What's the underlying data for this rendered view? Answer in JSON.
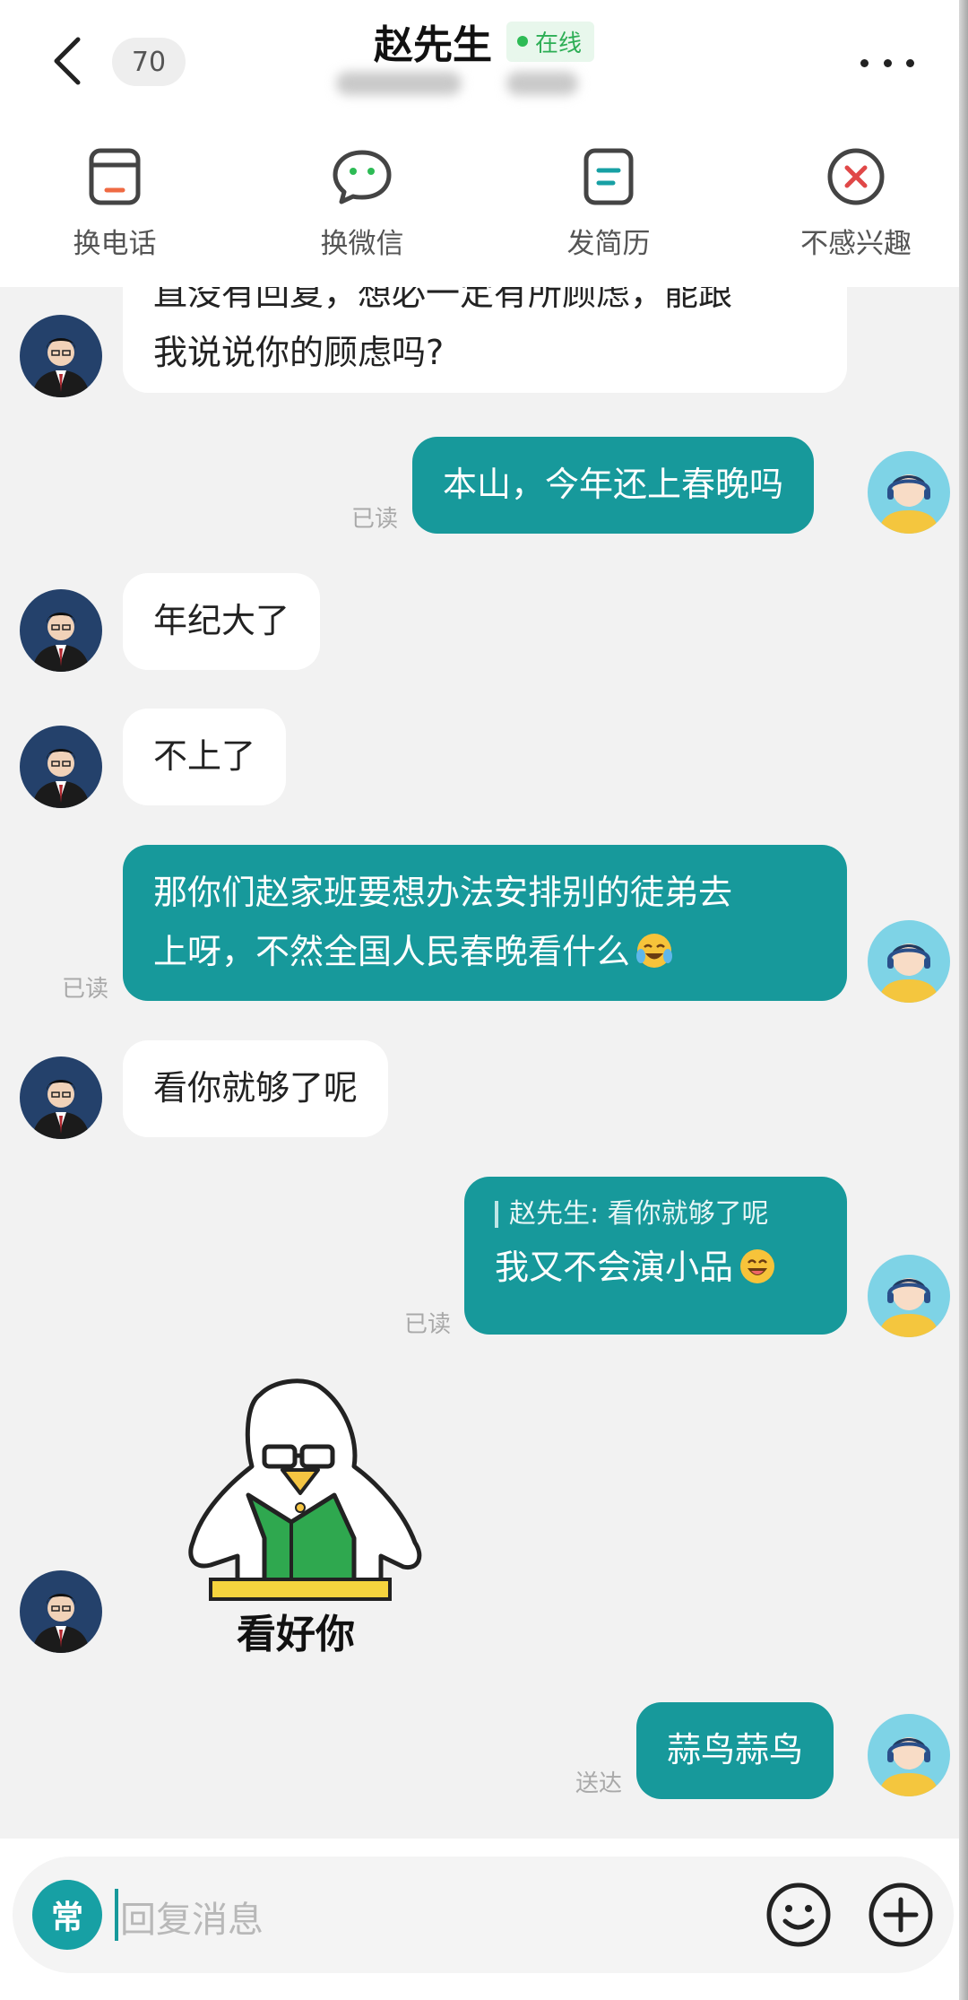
{
  "header": {
    "title": "赵先生",
    "status": "在线",
    "unread_count": "70"
  },
  "actions": [
    {
      "label": "换电话",
      "icon": "phone-card-icon"
    },
    {
      "label": "换微信",
      "icon": "wechat-icon"
    },
    {
      "label": "发简历",
      "icon": "resume-icon"
    },
    {
      "label": "不感兴趣",
      "icon": "not-interested-icon"
    }
  ],
  "messages": [
    {
      "from": "other",
      "text_line1": "直没有回复，想必一定有所顾虑，能跟",
      "text_line2": "我说说你的顾虑吗?"
    },
    {
      "from": "me",
      "text": "本山，今年还上春晚吗",
      "status": "已读"
    },
    {
      "from": "other",
      "text": "年纪大了"
    },
    {
      "from": "other",
      "text": "不上了"
    },
    {
      "from": "me",
      "text_line1": " 那你们赵家班要想办法安排别的徒弟去",
      "text_line2": "上呀，不然全国人民春晚看什么",
      "emoji": "crying-laughing-emoji",
      "status": "已读"
    },
    {
      "from": "other",
      "text": "看你就够了呢"
    },
    {
      "from": "me",
      "quote": "赵先生: 看你就够了呢",
      "text": "我又不会演小品",
      "emoji": "laughing-emoji",
      "status": "已读"
    },
    {
      "from": "other",
      "sticker_caption": "看好你",
      "sticker": "duck-sticker"
    },
    {
      "from": "me",
      "text": "蒜鸟蒜鸟",
      "status": "送达"
    }
  ],
  "input": {
    "common_label": "常",
    "placeholder": "回复消息"
  },
  "colors": {
    "accent": "#17999b",
    "online": "#2dae55",
    "not_interested": "#e04848"
  }
}
